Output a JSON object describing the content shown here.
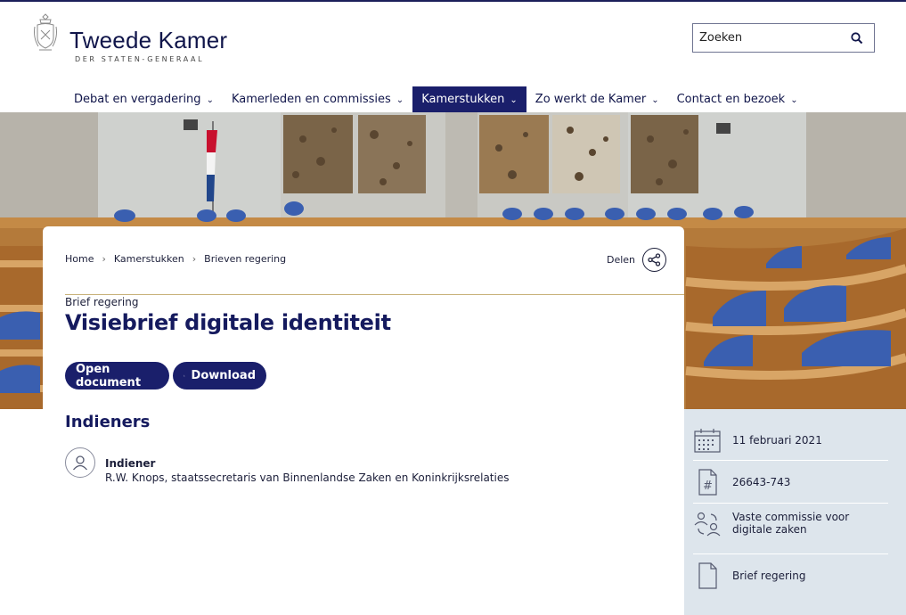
{
  "header": {
    "logo_title": "Tweede Kamer",
    "logo_subtitle": "DER STATEN-GENERAAL",
    "search_placeholder": "Zoeken"
  },
  "nav": {
    "items": [
      {
        "label": "Debat en vergadering",
        "active": false
      },
      {
        "label": "Kamerleden en commissies",
        "active": false
      },
      {
        "label": "Kamerstukken",
        "active": true
      },
      {
        "label": "Zo werkt de Kamer",
        "active": false
      },
      {
        "label": "Contact en bezoek",
        "active": false
      }
    ]
  },
  "breadcrumb": [
    "Home",
    "Kamerstukken",
    "Brieven regering"
  ],
  "share_label": "Delen",
  "document": {
    "type": "Brief regering",
    "title": "Visiebrief digitale identiteit",
    "open_label": "Open document",
    "download_label": "Download"
  },
  "indieners": {
    "section_title": "Indieners",
    "role": "Indiener",
    "name": "R.W. Knops, staatssecretaris van Binnenlandse Zaken en Koninkrijksrelaties"
  },
  "meta": {
    "date": "11 februari 2021",
    "number": "26643-743",
    "committee": "Vaste commissie voor digitale zaken",
    "kind": "Brief regering"
  },
  "colors": {
    "brand": "#1a1f6b",
    "side_panel": "#dde5ec"
  }
}
